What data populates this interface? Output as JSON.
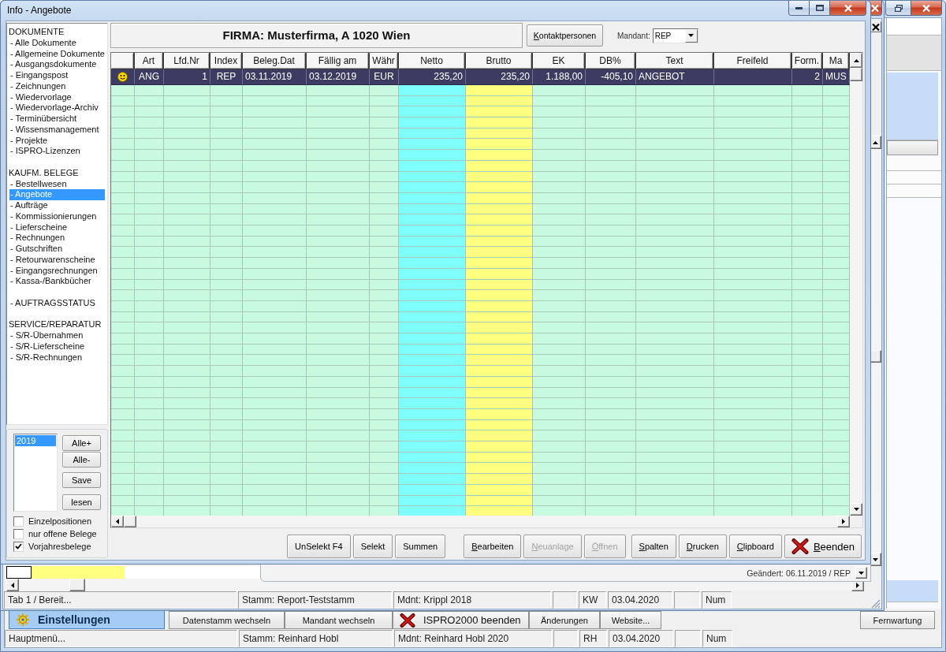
{
  "window": {
    "title": "Info - Angebote"
  },
  "sidebar": {
    "sections": [
      {
        "title": "DOKUMENTE",
        "items": [
          {
            "label": "- Alle Dokumente",
            "selected": false
          },
          {
            "label": "- Allgemeine Dokumente",
            "selected": false
          },
          {
            "label": "- Ausgangsdokumente",
            "selected": false
          },
          {
            "label": "- Eingangspost",
            "selected": false
          },
          {
            "label": "- Zeichnungen",
            "selected": false
          },
          {
            "label": "- Wiedervorlage",
            "selected": false
          },
          {
            "label": "- Wiedervorlage-Archiv",
            "selected": false
          },
          {
            "label": "- Terminübersicht",
            "selected": false
          },
          {
            "label": "- Wissensmanagement",
            "selected": false
          },
          {
            "label": "- Projekte",
            "selected": false
          },
          {
            "label": "- ISPRO-Lizenzen",
            "selected": false
          }
        ]
      },
      {
        "title": "KAUFM. BELEGE",
        "items": [
          {
            "label": "- Bestellwesen",
            "selected": false
          },
          {
            "label": "- Angebote",
            "selected": true
          },
          {
            "label": "- Aufträge",
            "selected": false
          },
          {
            "label": "- Kommissionierungen",
            "selected": false
          },
          {
            "label": "- Lieferscheine",
            "selected": false
          },
          {
            "label": "- Rechnungen",
            "selected": false
          },
          {
            "label": "- Gutschriften",
            "selected": false
          },
          {
            "label": "- Retourwarenscheine",
            "selected": false
          },
          {
            "label": "- Eingangsrechnungen",
            "selected": false
          },
          {
            "label": "- Kassa-/Bankbücher",
            "selected": false
          }
        ]
      },
      {
        "items": [
          {
            "label": "- AUFTRAGSSTATUS",
            "selected": false
          }
        ]
      },
      {
        "title": "SERVICE/REPARATUR",
        "items": [
          {
            "label": "- S/R-Übernahmen",
            "selected": false
          },
          {
            "label": "- S/R-Lieferscheine",
            "selected": false
          },
          {
            "label": "- S/R-Rechnungen",
            "selected": false
          }
        ]
      }
    ]
  },
  "year_filter": {
    "years": [
      {
        "label": "2019",
        "selected": true
      }
    ],
    "buttons": [
      "Alle+",
      "Alle-",
      "Save",
      "lesen"
    ],
    "options": [
      {
        "label": "Einzelpositionen",
        "checked": false
      },
      {
        "label": "nur offene Belege",
        "checked": false
      },
      {
        "label": "Vorjahresbelege",
        "checked": true
      }
    ]
  },
  "header": {
    "company": "FIRMA: Musterfirma, A 1020 Wien",
    "contacts_button": {
      "label": "Kontaktpersonen",
      "mnemonic": true
    },
    "mandant": {
      "label": "Mandant:",
      "value": "REP"
    }
  },
  "table": {
    "columns": [
      {
        "label": "Art",
        "kind": "code"
      },
      {
        "label": "Lfd.Nr",
        "kind": "number"
      },
      {
        "label": "Index",
        "kind": "code"
      },
      {
        "label": "Beleg.Dat",
        "kind": "text"
      },
      {
        "label": "Fällig am",
        "kind": "text"
      },
      {
        "label": "Währ",
        "kind": "code"
      },
      {
        "label": "Netto",
        "kind": "number",
        "color": "#80ffff"
      },
      {
        "label": "Brutto",
        "kind": "number",
        "color": "#ffff80"
      },
      {
        "label": "EK",
        "kind": "number"
      },
      {
        "label": "DB%",
        "kind": "number"
      },
      {
        "label": "Text",
        "kind": "text"
      },
      {
        "label": "Freifeld",
        "kind": "text"
      },
      {
        "label": "Form.",
        "kind": "number"
      },
      {
        "label": "Ma",
        "kind": "text"
      }
    ],
    "rows": [
      {
        "selected": true,
        "cells": [
          "ANG",
          "1",
          "REP",
          "03.11.2019",
          "03.12.2019",
          "EUR",
          "235,20",
          "235,20",
          "1.188,00",
          "-405,10",
          "ANGEBOT",
          null,
          "2",
          "MUS"
        ]
      }
    ]
  },
  "button_groups": [
    [
      {
        "label": "UnSelekt F4",
        "kind": "plain",
        "disabled": false,
        "mnemonic": false
      },
      {
        "label": "Selekt",
        "kind": "plain",
        "disabled": false,
        "mnemonic": false
      },
      {
        "label": "Summen",
        "kind": "plain",
        "disabled": false,
        "mnemonic": false
      }
    ],
    [
      {
        "label": "Bearbeiten",
        "kind": "plain",
        "disabled": false,
        "mnemonic": true
      },
      {
        "label": "Neuanlage",
        "kind": "plain",
        "disabled": true,
        "mnemonic": true
      },
      {
        "label": "Öffnen",
        "kind": "plain",
        "disabled": true,
        "mnemonic": true
      }
    ],
    [
      {
        "label": "Spalten",
        "kind": "plain",
        "disabled": false,
        "mnemonic": true
      },
      {
        "label": "Drucken",
        "kind": "plain",
        "disabled": false,
        "mnemonic": true
      },
      {
        "label": "Clipboard",
        "kind": "plain",
        "disabled": false,
        "mnemonic": true
      },
      {
        "label": "Beenden",
        "kind": "icon",
        "disabled": false,
        "mnemonic": true
      }
    ]
  ],
  "background_window": {
    "modified": "Geändert: 06.11.2019 / REP",
    "status_bar": {
      "message": "Tab 1 / Bereit...",
      "stamm": "Stamm: Report-Teststamm",
      "mandant": "Mdnt: Krippl 2018",
      "user": "KW",
      "date": "03.04.2020",
      "keys": "Num"
    }
  },
  "main_window": {
    "toolbar": [
      {
        "label": "Einstellungen",
        "kind": "primary"
      },
      {
        "label": "Datenstamm wechseln",
        "kind": "plain"
      },
      {
        "label": "Mandant wechseln",
        "kind": "plain"
      },
      {
        "label": "ISPRO2000 beenden",
        "kind": "icon"
      },
      {
        "label": "Änderungen",
        "kind": "plain"
      },
      {
        "label": "Website...",
        "kind": "plain"
      }
    ],
    "remote_button": {
      "label": "Fernwartung"
    },
    "status_bar": {
      "message": "Hauptmenü...",
      "stamm": "Stamm: Reinhard Hobl",
      "mandant": "Mdnt: Reinhard Hobl 2020",
      "user": "RH",
      "date": "03.04.2020",
      "keys": "Num"
    }
  }
}
